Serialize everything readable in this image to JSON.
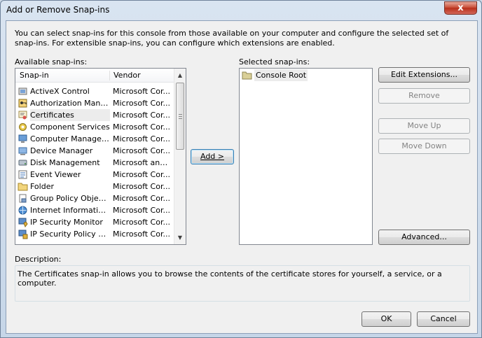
{
  "window": {
    "title": "Add or Remove Snap-ins",
    "close_glyph": "x"
  },
  "intro_text": "You can select snap-ins for this console from those available on your computer and configure the selected set of snap-ins. For extensible snap-ins, you can configure which extensions are enabled.",
  "available": {
    "label": "Available snap-ins:",
    "columns": [
      "Snap-in",
      "Vendor"
    ],
    "rows": [
      {
        "name": "ActiveX Control",
        "vendor": "Microsoft Cor...",
        "icon": "activex-icon"
      },
      {
        "name": "Authorization Manager",
        "vendor": "Microsoft Cor...",
        "icon": "authorization-icon"
      },
      {
        "name": "Certificates",
        "vendor": "Microsoft Cor...",
        "icon": "certificates-icon"
      },
      {
        "name": "Component Services",
        "vendor": "Microsoft Cor...",
        "icon": "component-services-icon"
      },
      {
        "name": "Computer Managem...",
        "vendor": "Microsoft Cor...",
        "icon": "computer-management-icon"
      },
      {
        "name": "Device Manager",
        "vendor": "Microsoft Cor...",
        "icon": "device-manager-icon"
      },
      {
        "name": "Disk Management",
        "vendor": "Microsoft and...",
        "icon": "disk-management-icon"
      },
      {
        "name": "Event Viewer",
        "vendor": "Microsoft Cor...",
        "icon": "event-viewer-icon"
      },
      {
        "name": "Folder",
        "vendor": "Microsoft Cor...",
        "icon": "folder-icon"
      },
      {
        "name": "Group Policy Object ...",
        "vendor": "Microsoft Cor...",
        "icon": "group-policy-icon"
      },
      {
        "name": "Internet Informatio...",
        "vendor": "Microsoft Cor...",
        "icon": "iis-icon"
      },
      {
        "name": "IP Security Monitor",
        "vendor": "Microsoft Cor...",
        "icon": "ip-security-monitor-icon"
      },
      {
        "name": "IP Security Policy M...",
        "vendor": "Microsoft Cor...",
        "icon": "ip-security-policy-icon"
      }
    ],
    "selected_index": 2
  },
  "add_button": "Add >",
  "selected": {
    "label": "Selected snap-ins:",
    "items": [
      {
        "name": "Console Root",
        "icon": "console-root-folder-icon"
      }
    ]
  },
  "buttons": {
    "edit_extensions": "Edit Extensions...",
    "remove": "Remove",
    "move_up": "Move Up",
    "move_down": "Move Down",
    "advanced": "Advanced...",
    "ok": "OK",
    "cancel": "Cancel"
  },
  "description": {
    "label": "Description:",
    "text": "The Certificates snap-in allows you to browse the contents of the certificate stores for yourself, a service, or a computer."
  }
}
